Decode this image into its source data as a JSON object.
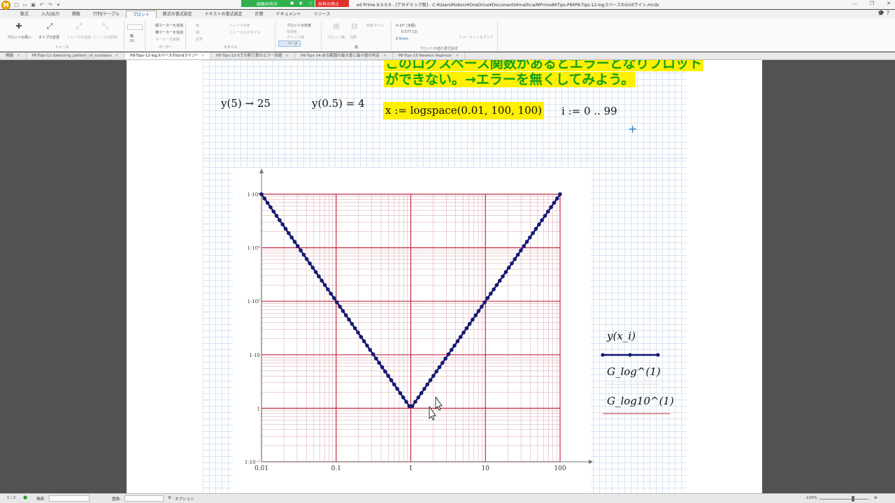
{
  "titlebar": {
    "app_logo": "M",
    "share_label": "画面共有中",
    "stop_label": "共有の停止",
    "window_title": "ed Prime 9.0.0.0 - [アカデミック版] - C:¥Users¥tokoro¥OneDrive¥Documents¥mathcad¥Prime8¥Tips-P8¥P8-Tips-12-logスペースのGridライン.mcdx"
  },
  "ribbon_tabs": [
    "数式",
    "入力/出力",
    "関数",
    "行列/テーブル",
    "プロット",
    "数式の書式設定",
    "テキストの書式設定",
    "計算",
    "ドキュメント",
    "リソース"
  ],
  "ribbon_active_tab": "プロット",
  "ribbon": {
    "insert_plot": "プロットの挿入",
    "change_type": "タイプの変更",
    "add_trace": "トレースの追加",
    "delete_trace": "トレースの削除",
    "group_trace": "トレース",
    "axis_label": "軸",
    "axis_value": "(X)",
    "add_v_marker": "縦マーカーを追加",
    "add_h_marker": "横マーカーを追加",
    "delete_marker": "マーカーを削除",
    "group_marker": "マーカー",
    "color": "色",
    "line": "線",
    "symbol": "記号",
    "add_trace2": "トレースの色",
    "trace_style": "トレースのスタイル",
    "group_style": "スタイル",
    "plot_bg": "プロットの背景",
    "bg_color": "背景色",
    "gridlines": "グリッド線",
    "base": "ベース",
    "plot_axis": "プロット軸",
    "log": "対数",
    "tick_label": "目盛ラベル",
    "group_axis": "軸",
    "num_format": "0-10⁰ (全般)",
    "num_value": "0.577 (3)",
    "num_unit": "0.5mm",
    "group_plot_values": "プロットの値の書式設定",
    "format_clear": "フォーマットをクリア"
  },
  "doc_tabs": [
    {
      "label": "無題",
      "active": false
    },
    {
      "label": "P8-Tips-11-Selecting_pattern_of_numbers",
      "active": false
    },
    {
      "label": "P8-Tips-12-logスペースのGridライン*",
      "active": true
    },
    {
      "label": "P8-Tips-13-0での割り算のエラー回避",
      "active": false
    },
    {
      "label": "P8-Tips-14-ある範囲の最大値と最小値の判定",
      "active": false
    },
    {
      "label": "P8-Tips-15-Newton Raphson",
      "active": false
    }
  ],
  "worksheet": {
    "note_line1": "このログスペース関数があるとエラーとなりプロット",
    "note_line2": "ができない。→エラーを無くしてみよう。",
    "eq1": "y(5) → 25",
    "eq2": "y(0.5) = 4",
    "eq3": "x := logspace(0.01, 100, 100)",
    "eq4": "i := 0 .. 99"
  },
  "chart_data": {
    "type": "line",
    "xscale": "log",
    "yscale": "log",
    "xlim": [
      0.01,
      100
    ],
    "ylim": [
      0.1,
      10000
    ],
    "x_ticks": [
      "0.01",
      "0.1",
      "1",
      "10",
      "100"
    ],
    "y_ticks": [
      "1·10⁻¹",
      "1",
      "1·10",
      "1·10²",
      "1·10³",
      "1·10⁴"
    ],
    "grid": true,
    "grid_color": "#c8283c",
    "series_color": "#151a73",
    "marker": "circle",
    "points": 100,
    "legend": [
      {
        "label": "y(x_i)",
        "style": "line-marker",
        "color": "#151a73"
      },
      {
        "label": "G_log^(1)",
        "style": "none",
        "color": "#cccccc"
      },
      {
        "label": "G_log10^(1)",
        "style": "line",
        "color": "#d9534f"
      }
    ]
  },
  "statusbar": {
    "page": "1 / 2",
    "search_label": "検索:",
    "replace_label": "置換:",
    "options_label": "オプション",
    "zoom": "229%"
  }
}
